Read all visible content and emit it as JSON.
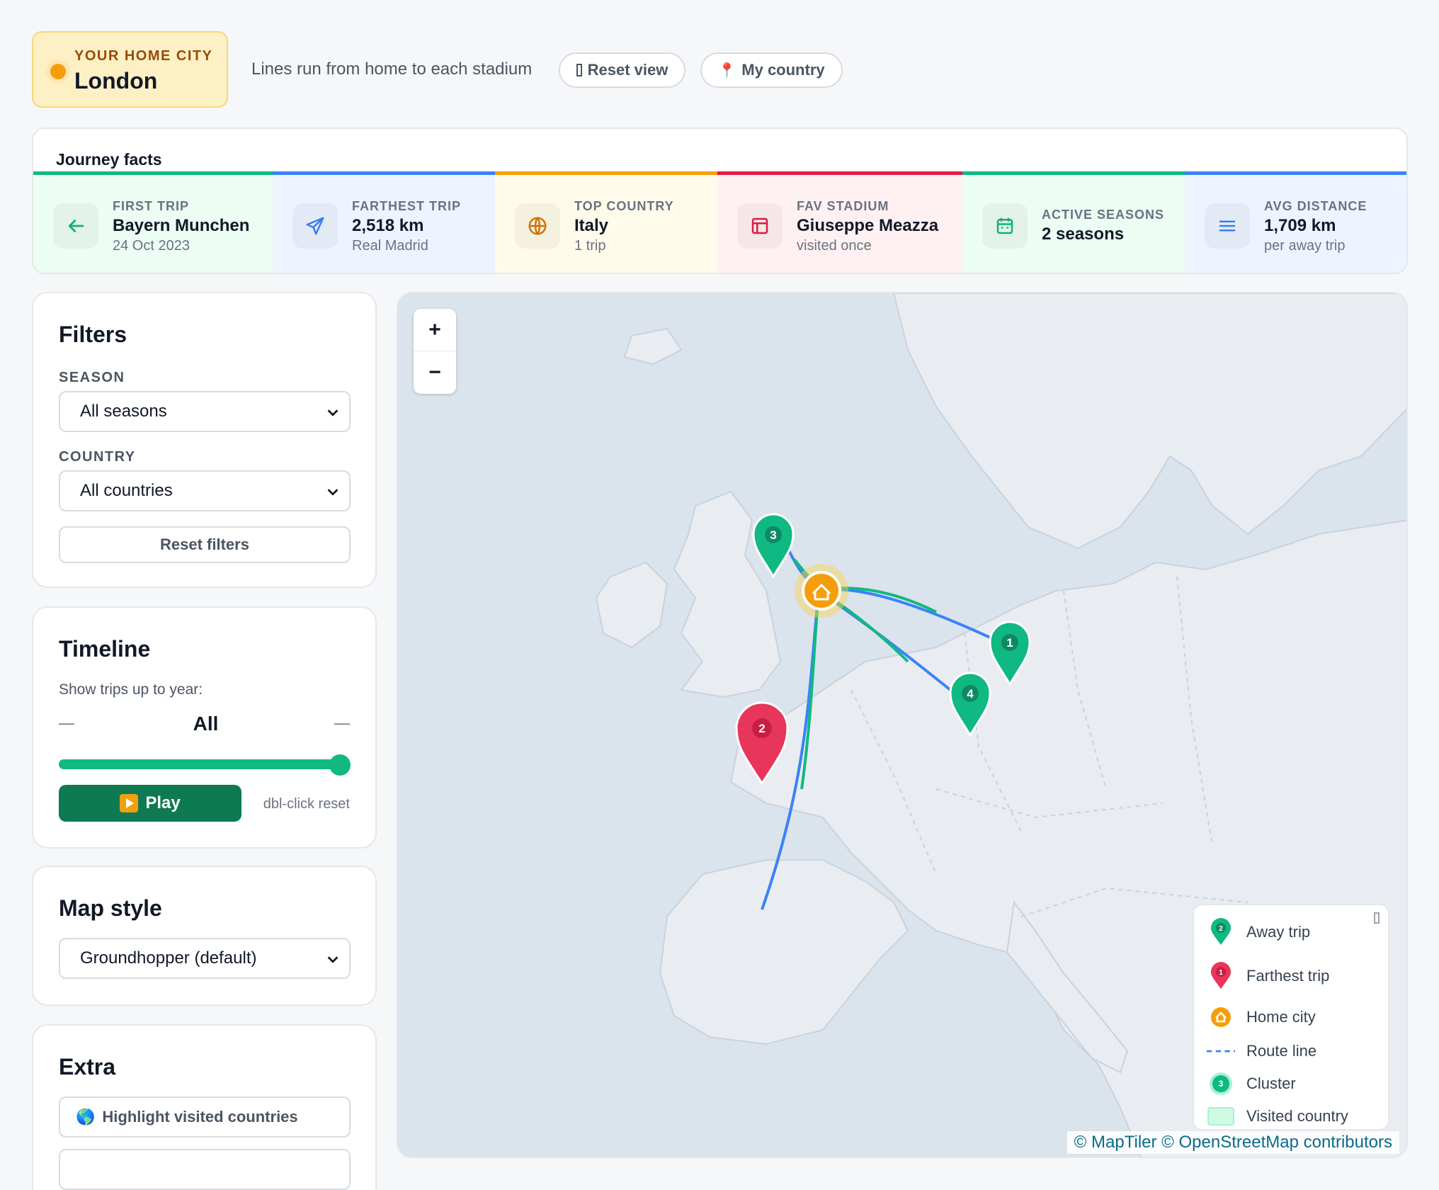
{
  "home": {
    "kicker": "YOUR HOME CITY",
    "city": "London"
  },
  "topbar": {
    "hint": "Lines run from home to each stadium",
    "reset_view": "Reset view",
    "my_country": "My country"
  },
  "facts": {
    "title": "Journey facts",
    "items": [
      {
        "label": "FIRST TRIP",
        "value": "Bayern Munchen",
        "sub": "24 Oct 2023",
        "icon": "arrow-left-icon",
        "accent": "#10b981",
        "bg": "#ecfdf3"
      },
      {
        "label": "FARTHEST TRIP",
        "value": "2,518 km",
        "sub": "Real Madrid",
        "icon": "send-icon",
        "accent": "#3b82f6",
        "bg": "#eef4ff"
      },
      {
        "label": "TOP COUNTRY",
        "value": "Italy",
        "sub": "1 trip",
        "icon": "globe-icon",
        "accent": "#f59e0b",
        "bg": "#fffbea"
      },
      {
        "label": "FAV STADIUM",
        "value": "Giuseppe Meazza",
        "sub": "visited once",
        "icon": "stadium-icon",
        "accent": "#e11d48",
        "bg": "#fff1f2"
      },
      {
        "label": "ACTIVE SEASONS",
        "value": "2 seasons",
        "sub": "",
        "icon": "calendar-icon",
        "accent": "#10b981",
        "bg": "#ecfdf3"
      },
      {
        "label": "AVG DISTANCE",
        "value": "1,709 km",
        "sub": "per away trip",
        "icon": "menu-icon",
        "accent": "#3b82f6",
        "bg": "#eef4ff"
      }
    ]
  },
  "filters": {
    "title": "Filters",
    "season_label": "SEASON",
    "season_value": "All seasons",
    "country_label": "COUNTRY",
    "country_value": "All countries",
    "reset": "Reset filters"
  },
  "timeline": {
    "title": "Timeline",
    "caption": "Show trips up to year:",
    "min": "—",
    "value": "All",
    "max": "—",
    "progress": 1.0,
    "play": "Play",
    "hint": "dbl-click reset"
  },
  "map_style": {
    "title": "Map style",
    "value": "Groundhopper (default)"
  },
  "extra": {
    "title": "Extra",
    "highlight": "Highlight visited countries"
  },
  "map": {
    "zoom_in": "+",
    "zoom_out": "−",
    "markers": [
      {
        "label": "3",
        "kind": "away"
      },
      {
        "label": "1",
        "kind": "away"
      },
      {
        "label": "4",
        "kind": "away"
      },
      {
        "label": "2",
        "kind": "farthest"
      }
    ],
    "legend": [
      {
        "label": "Away trip",
        "symbol": "2"
      },
      {
        "label": "Farthest trip",
        "symbol": "1"
      },
      {
        "label": "Home city",
        "symbol": "home-icon"
      },
      {
        "label": "Route line",
        "symbol": "dashed-line"
      },
      {
        "label": "Cluster",
        "symbol": "3"
      },
      {
        "label": "Visited country",
        "symbol": "swatch"
      }
    ],
    "attribution": "© MapTiler © OpenStreetMap contributors",
    "colors": {
      "away": "#10b981",
      "farthest": "#e8365a",
      "home": "#f59e0b",
      "route": "#3b82f6",
      "water": "#dbe3ec",
      "land": "#e9ecf1"
    }
  }
}
